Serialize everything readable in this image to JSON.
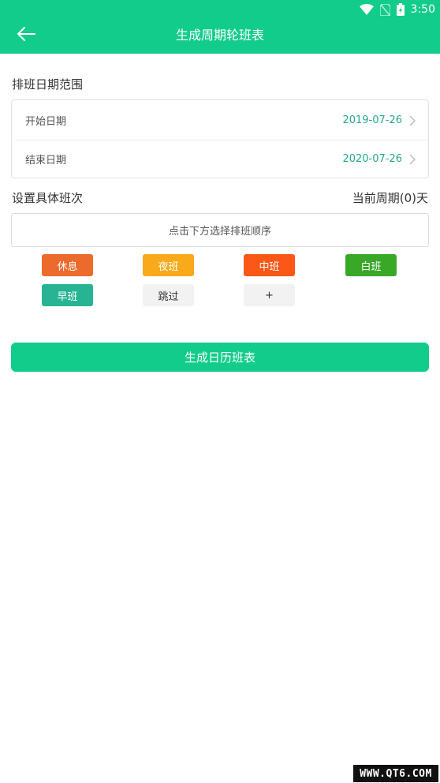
{
  "status": {
    "time": "3:50"
  },
  "header": {
    "title": "生成周期轮班表",
    "back_icon": "arrow-left-icon"
  },
  "date_range": {
    "title": "排班日期范围",
    "start_label": "开始日期",
    "start_value": "2019-07-26",
    "end_label": "结束日期",
    "end_value": "2020-07-26"
  },
  "shift_setup": {
    "title": "设置具体班次",
    "cycle_text": "当前周期(0)天",
    "order_placeholder": "点击下方选择排班顺序"
  },
  "shifts": [
    {
      "label": "休息",
      "color": "#ec6a2c"
    },
    {
      "label": "夜班",
      "color": "#f8aa1b"
    },
    {
      "label": "中班",
      "color": "#fb5716"
    },
    {
      "label": "白班",
      "color": "#3aa827"
    },
    {
      "label": "早班",
      "color": "#27b493"
    },
    {
      "label": "跳过",
      "color": "#f2f2f2"
    },
    {
      "label": "+",
      "color": "#f2f2f2"
    }
  ],
  "generate_button": {
    "label": "生成日历班表"
  },
  "watermark": {
    "text": "WWW.QT6.COM"
  },
  "colors": {
    "accent": "#12cc8c",
    "date_value": "#26a88a"
  }
}
